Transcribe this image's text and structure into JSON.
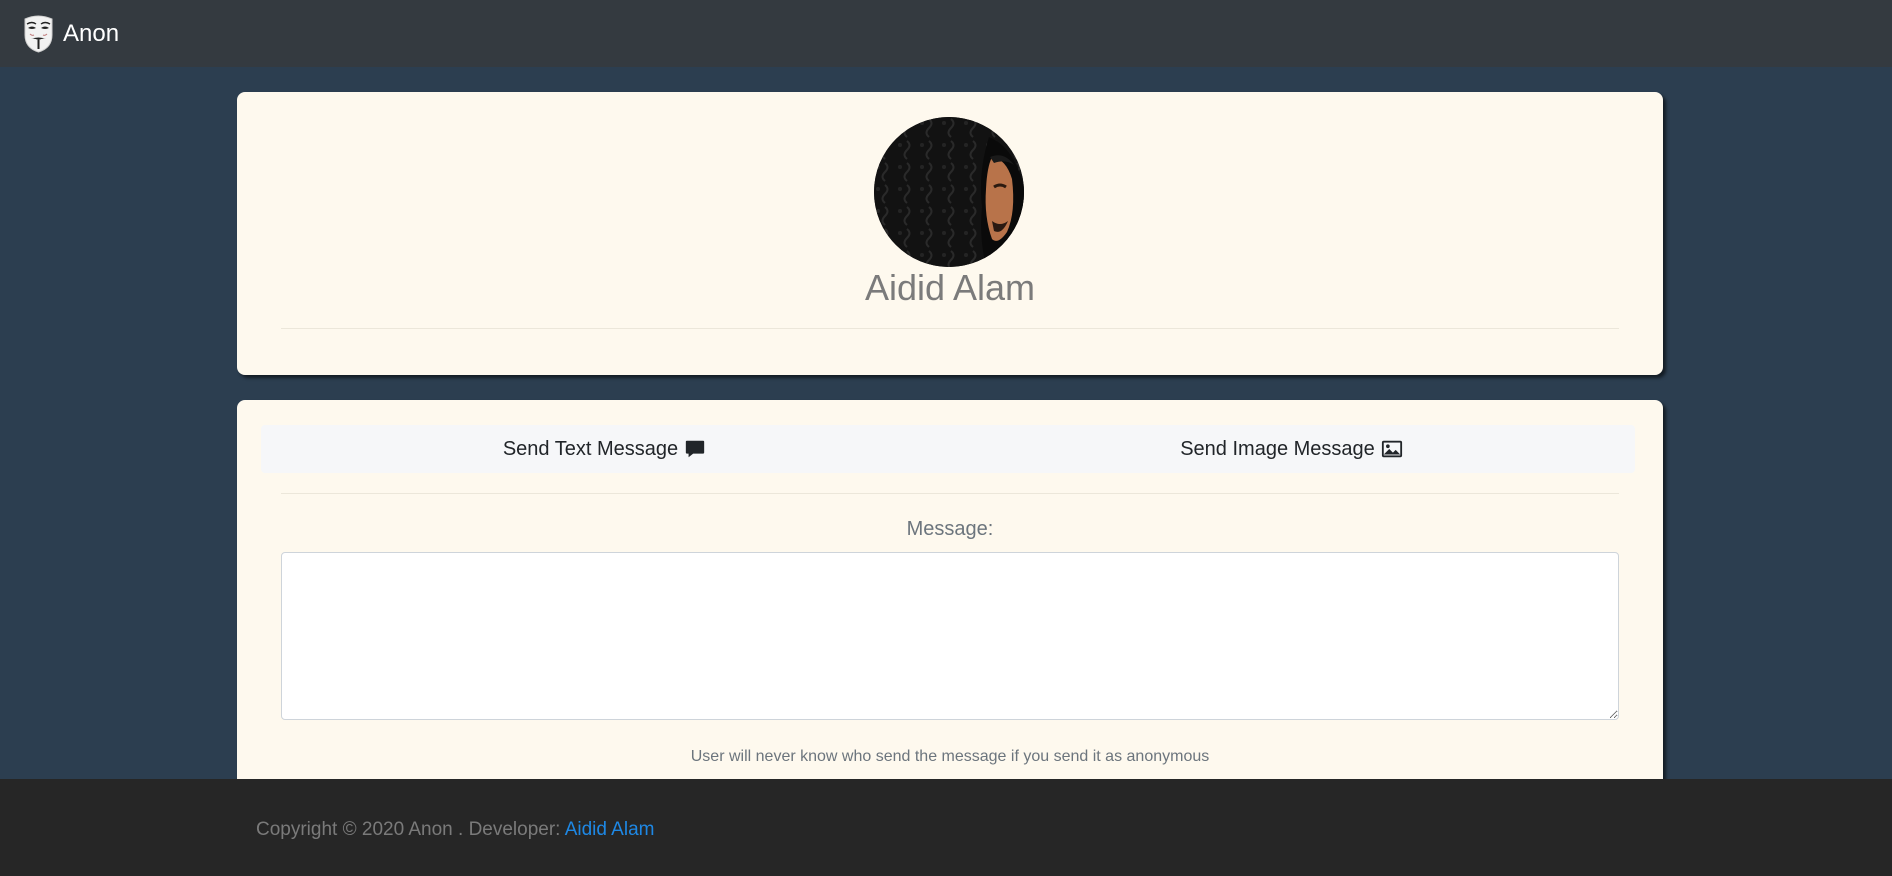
{
  "navbar": {
    "brand": "Anon",
    "brand_icon": "anonymous-mask-icon",
    "bg_color": "#343a40"
  },
  "profile": {
    "name": "Aidid Alam",
    "avatar": "profile-photo"
  },
  "compose": {
    "tabs": [
      {
        "label": "Send Text Message",
        "icon": "chat-bubble-icon"
      },
      {
        "label": "Send Image Message",
        "icon": "image-icon"
      }
    ],
    "message_label": "Message:",
    "message_value": "",
    "note": "User will never know who send the message if you send it as anonymous"
  },
  "footer": {
    "copyright": "Copyright © 2020 Anon . Developer: ",
    "developer_link": "Aidid Alam",
    "link_color": "#1e88e5"
  },
  "colors": {
    "page_bg": "#2c3e50",
    "card_bg": "#fef9ee",
    "footer_bg": "#262626"
  }
}
